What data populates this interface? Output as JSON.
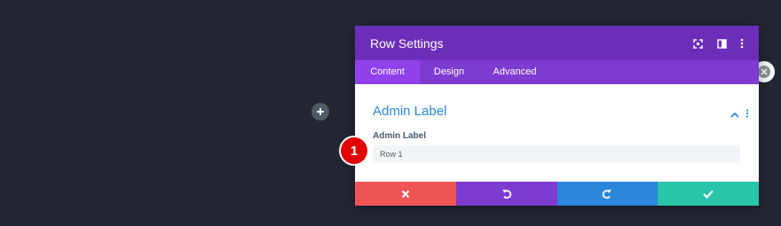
{
  "modal": {
    "title": "Row Settings",
    "tabs": [
      {
        "label": "Content",
        "active": true
      },
      {
        "label": "Design",
        "active": false
      },
      {
        "label": "Advanced",
        "active": false
      }
    ]
  },
  "section": {
    "title": "Admin Label",
    "field_label": "Admin Label",
    "field_value": "Row 1"
  },
  "badge": {
    "number": "1"
  },
  "colors": {
    "header": "#6c2eb9",
    "tabs": "#7e3bd0",
    "active_tab": "#8f42ec",
    "cancel": "#ef5555",
    "undo": "#7e3bd0",
    "redo": "#2b87da",
    "save": "#29c4a9",
    "accent_text": "#2b87da"
  },
  "icons": {
    "add": "plus-icon",
    "header": [
      "fullscreen-icon",
      "split-view-icon",
      "more-vertical-icon"
    ],
    "footer": [
      "close-icon",
      "undo-icon",
      "redo-icon",
      "check-icon"
    ]
  }
}
